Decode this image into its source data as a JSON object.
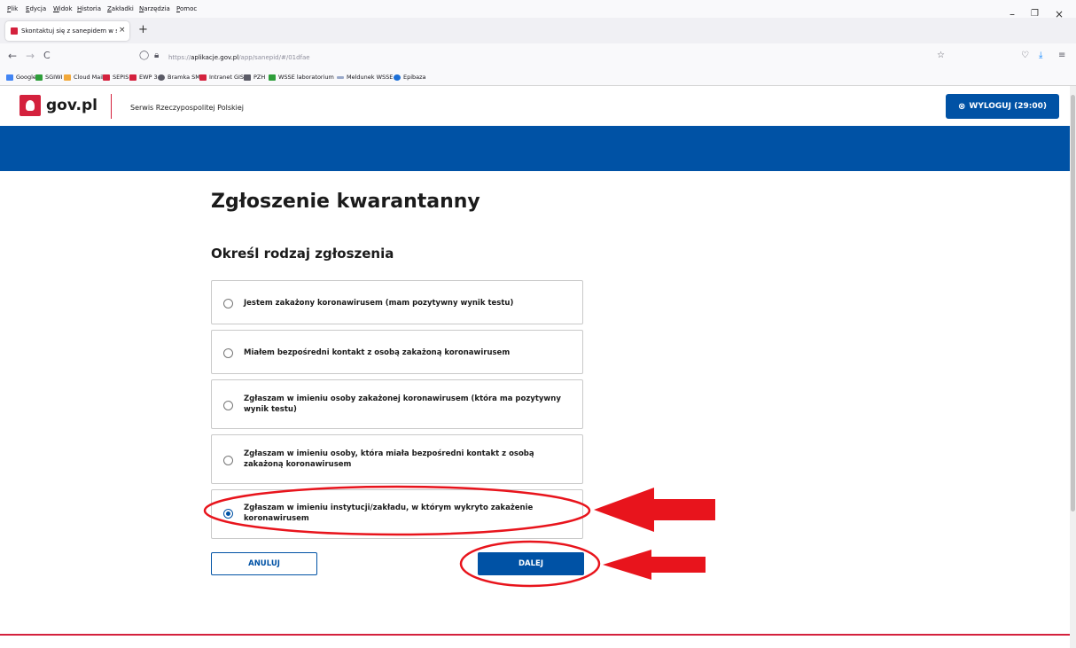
{
  "menu": [
    "Plik",
    "Edycja",
    "Widok",
    "Historia",
    "Zakładki",
    "Narzędzia",
    "Pomoc"
  ],
  "window_controls": {
    "minimize": "–",
    "restore": "❐",
    "close": "×"
  },
  "tab": {
    "title": "Skontaktuj się z sanepidem w sp",
    "close": "×",
    "new_tab": "+"
  },
  "nav": {
    "back": "←",
    "forward": "→",
    "reload": "C"
  },
  "url": {
    "prefix": "https://",
    "host": "aplikacje.gov.pl",
    "path": "/app/sanepid/#/01dfae"
  },
  "bookmarks": [
    {
      "label": "Google",
      "color": "#4285f4"
    },
    {
      "label": "SGIWI",
      "color": "#2e9e3a"
    },
    {
      "label": "Cloud Mail",
      "color": "#f2a93b"
    },
    {
      "label": "SEPIS",
      "color": "#d4213d"
    },
    {
      "label": "EWP 3",
      "color": "#d4213d"
    },
    {
      "label": "Bramka SMS",
      "color": "#5b5b66"
    },
    {
      "label": "Intranet GIS",
      "color": "#d4213d"
    },
    {
      "label": "PZH",
      "color": "#5b5b66"
    },
    {
      "label": "WSSE laboratorium",
      "color": "#2e9e3a"
    },
    {
      "label": "Meldunek WSSE",
      "color": "#9aa9c9"
    },
    {
      "label": "Epibaza",
      "color": "#1c6fd6"
    }
  ],
  "header": {
    "logo_text": "gov.pl",
    "service": "Serwis Rzeczypospolitej Polskiej",
    "logout": "WYLOGUJ (29:00)"
  },
  "page": {
    "title": "Zgłoszenie kwarantanny",
    "subtitle": "Określ rodzaj zgłoszenia"
  },
  "options": [
    {
      "label": "Jestem zakażony koronawirusem (mam pozytywny wynik testu)",
      "checked": false
    },
    {
      "label": "Miałem bezpośredni kontakt z osobą zakażoną koronawirusem",
      "checked": false
    },
    {
      "label": "Zgłaszam w imieniu osoby zakażonej koronawirusem (która ma pozytywny wynik testu)",
      "checked": false
    },
    {
      "label": "Zgłaszam w imieniu osoby, która miała bezpośredni kontakt z osobą zakażoną koronawirusem",
      "checked": false
    },
    {
      "label": "Zgłaszam w imieniu instytucji/zakładu, w którym wykryto zakażenie koronawirusem",
      "checked": true
    }
  ],
  "buttons": {
    "cancel": "ANULUJ",
    "next": "DALEJ"
  },
  "colors": {
    "brand_blue": "#0052a5",
    "brand_red": "#d4213d",
    "annotation_red": "#e8141c"
  }
}
